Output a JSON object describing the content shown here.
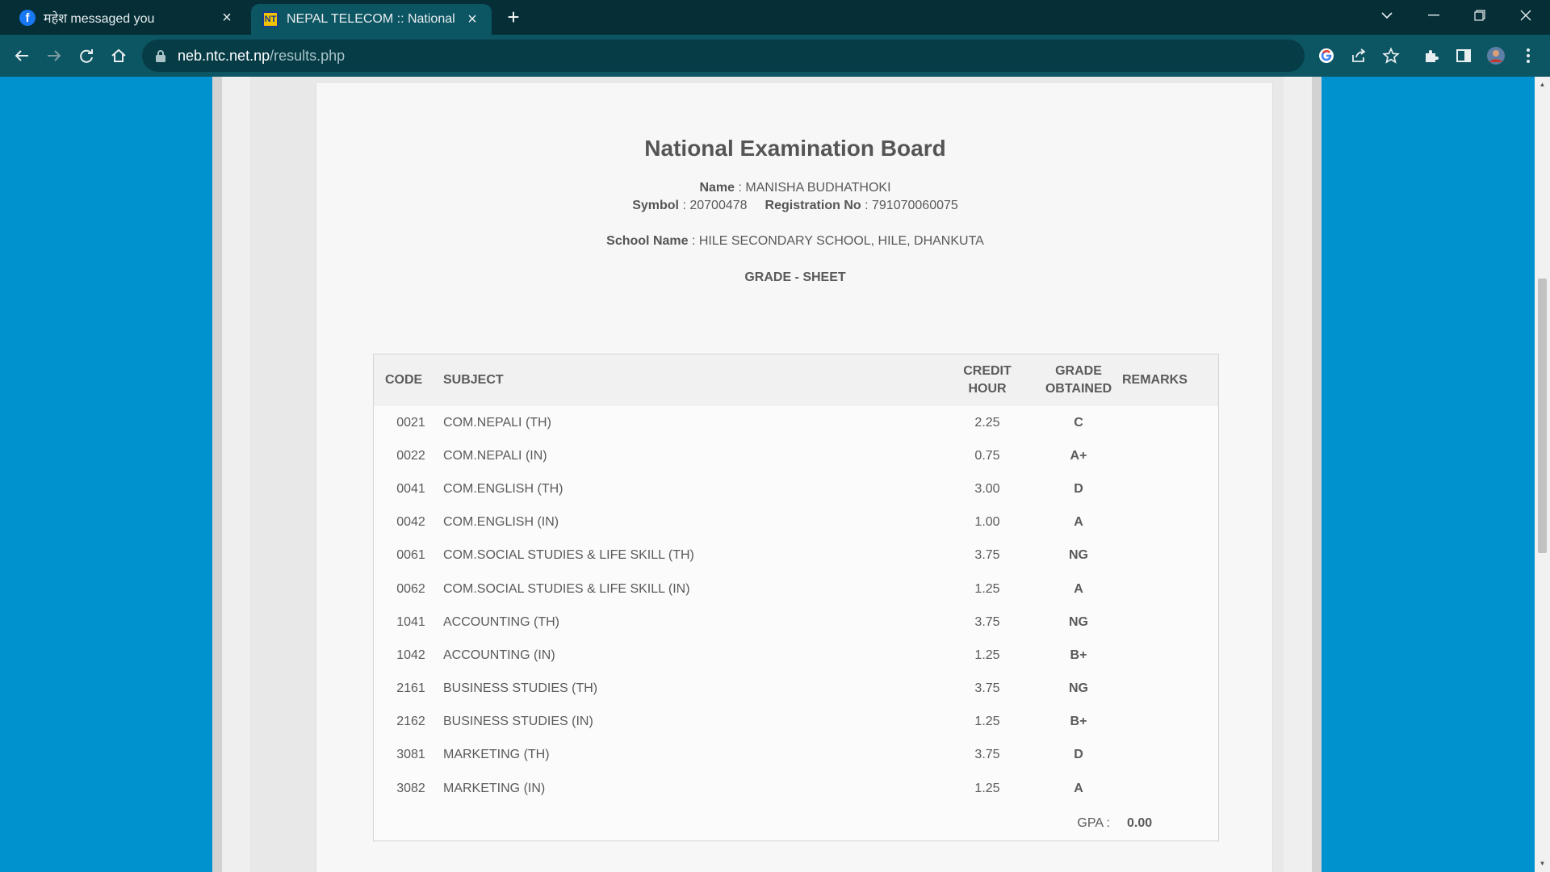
{
  "browser": {
    "tabs": [
      {
        "title": "महेश messaged you",
        "favicon": "facebook-icon",
        "active": false
      },
      {
        "title": "NEPAL TELECOM :: National Exam",
        "favicon": "ntc-icon",
        "active": true
      }
    ],
    "url": {
      "host": "neb.ntc.net.np",
      "path": "/results.php"
    },
    "colors": {
      "tabstrip": "#052e36",
      "toolbar": "#0c5562",
      "page_bg": "#0091cf"
    }
  },
  "page": {
    "board_title": "National Examination Board",
    "name_label": "Name",
    "name_value": "MANISHA BUDHATHOKI",
    "symbol_label": "Symbol",
    "symbol_value": "20700478",
    "registration_label": "Registration No",
    "registration_value": "791070060075",
    "school_label": "School Name",
    "school_value": "HILE SECONDARY SCHOOL, HILE, DHANKUTA",
    "sheet_title": "GRADE - SHEET",
    "columns": {
      "code": "CODE",
      "subject": "SUBJECT",
      "credit_1": "CREDIT",
      "credit_2": "HOUR",
      "grade_1": "GRADE",
      "grade_2": "OBTAINED",
      "remarks": "REMARKS"
    },
    "rows": [
      {
        "code": "0021",
        "subject": "COM.NEPALI (TH)",
        "credit": "2.25",
        "grade": "C"
      },
      {
        "code": "0022",
        "subject": "COM.NEPALI (IN)",
        "credit": "0.75",
        "grade": "A+"
      },
      {
        "code": "0041",
        "subject": "COM.ENGLISH (TH)",
        "credit": "3.00",
        "grade": "D"
      },
      {
        "code": "0042",
        "subject": "COM.ENGLISH (IN)",
        "credit": "1.00",
        "grade": "A"
      },
      {
        "code": "0061",
        "subject": "COM.SOCIAL STUDIES & LIFE SKILL (TH)",
        "credit": "3.75",
        "grade": "NG"
      },
      {
        "code": "0062",
        "subject": "COM.SOCIAL STUDIES & LIFE SKILL (IN)",
        "credit": "1.25",
        "grade": "A"
      },
      {
        "code": "1041",
        "subject": "ACCOUNTING (TH)",
        "credit": "3.75",
        "grade": "NG"
      },
      {
        "code": "1042",
        "subject": "ACCOUNTING (IN)",
        "credit": "1.25",
        "grade": "B+"
      },
      {
        "code": "2161",
        "subject": "BUSINESS STUDIES (TH)",
        "credit": "3.75",
        "grade": "NG"
      },
      {
        "code": "2162",
        "subject": "BUSINESS STUDIES (IN)",
        "credit": "1.25",
        "grade": "B+"
      },
      {
        "code": "3081",
        "subject": "MARKETING (TH)",
        "credit": "3.75",
        "grade": "D"
      },
      {
        "code": "3082",
        "subject": "MARKETING (IN)",
        "credit": "1.25",
        "grade": "A"
      }
    ],
    "gpa_label": "GPA :",
    "gpa_value": "0.00"
  }
}
